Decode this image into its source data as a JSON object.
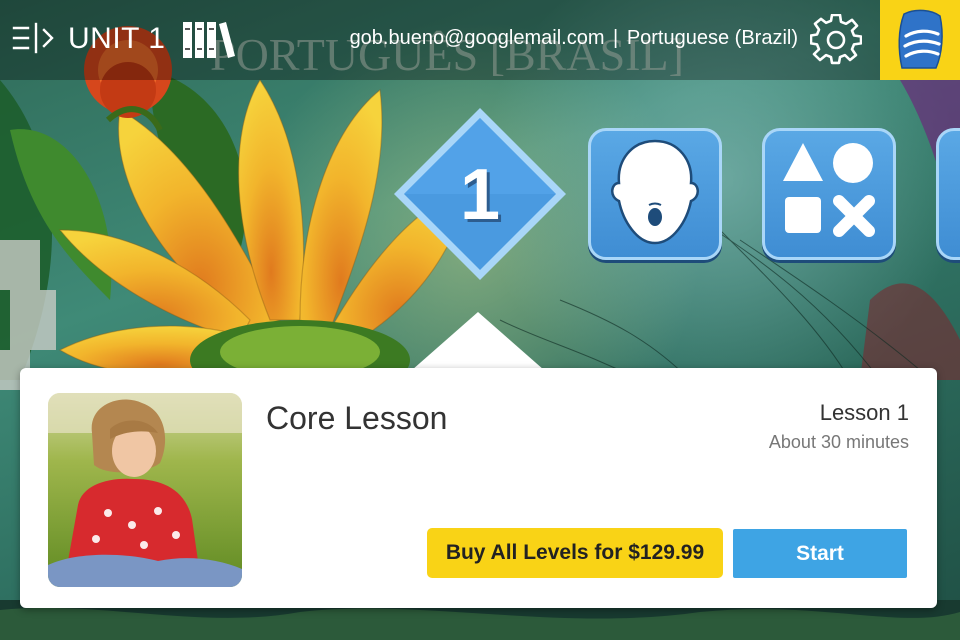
{
  "header": {
    "menu_icon": "sidebar-menu-icon",
    "unit_title": "UNIT 1",
    "library_icon": "library-books-icon",
    "account_email": "gob.bueno@googlemail.com",
    "separator": "|",
    "course_language": "Portuguese (Brazil)",
    "settings_icon": "gear-icon",
    "brand_logo": "rosetta-stone-logo"
  },
  "background": {
    "painted_sign_text": "PORTUGUÊS [BRASIL]"
  },
  "lesson_path": {
    "items": [
      {
        "kind": "core-lesson",
        "label": "1",
        "selected": true
      },
      {
        "kind": "pronunciation",
        "icon": "face-speaking-icon"
      },
      {
        "kind": "shapes-activity",
        "icon": "shapes-icon"
      },
      {
        "kind": "more",
        "icon": "partial-tile"
      }
    ]
  },
  "lesson_card": {
    "title": "Core Lesson",
    "lesson_number": "Lesson 1",
    "duration": "About 30 minutes",
    "buy_label": "Buy All Levels for $129.99",
    "start_label": "Start"
  },
  "colors": {
    "brand_yellow": "#f9d316",
    "tile_blue": "#4a9ae0",
    "start_blue": "#3ea4e4"
  }
}
